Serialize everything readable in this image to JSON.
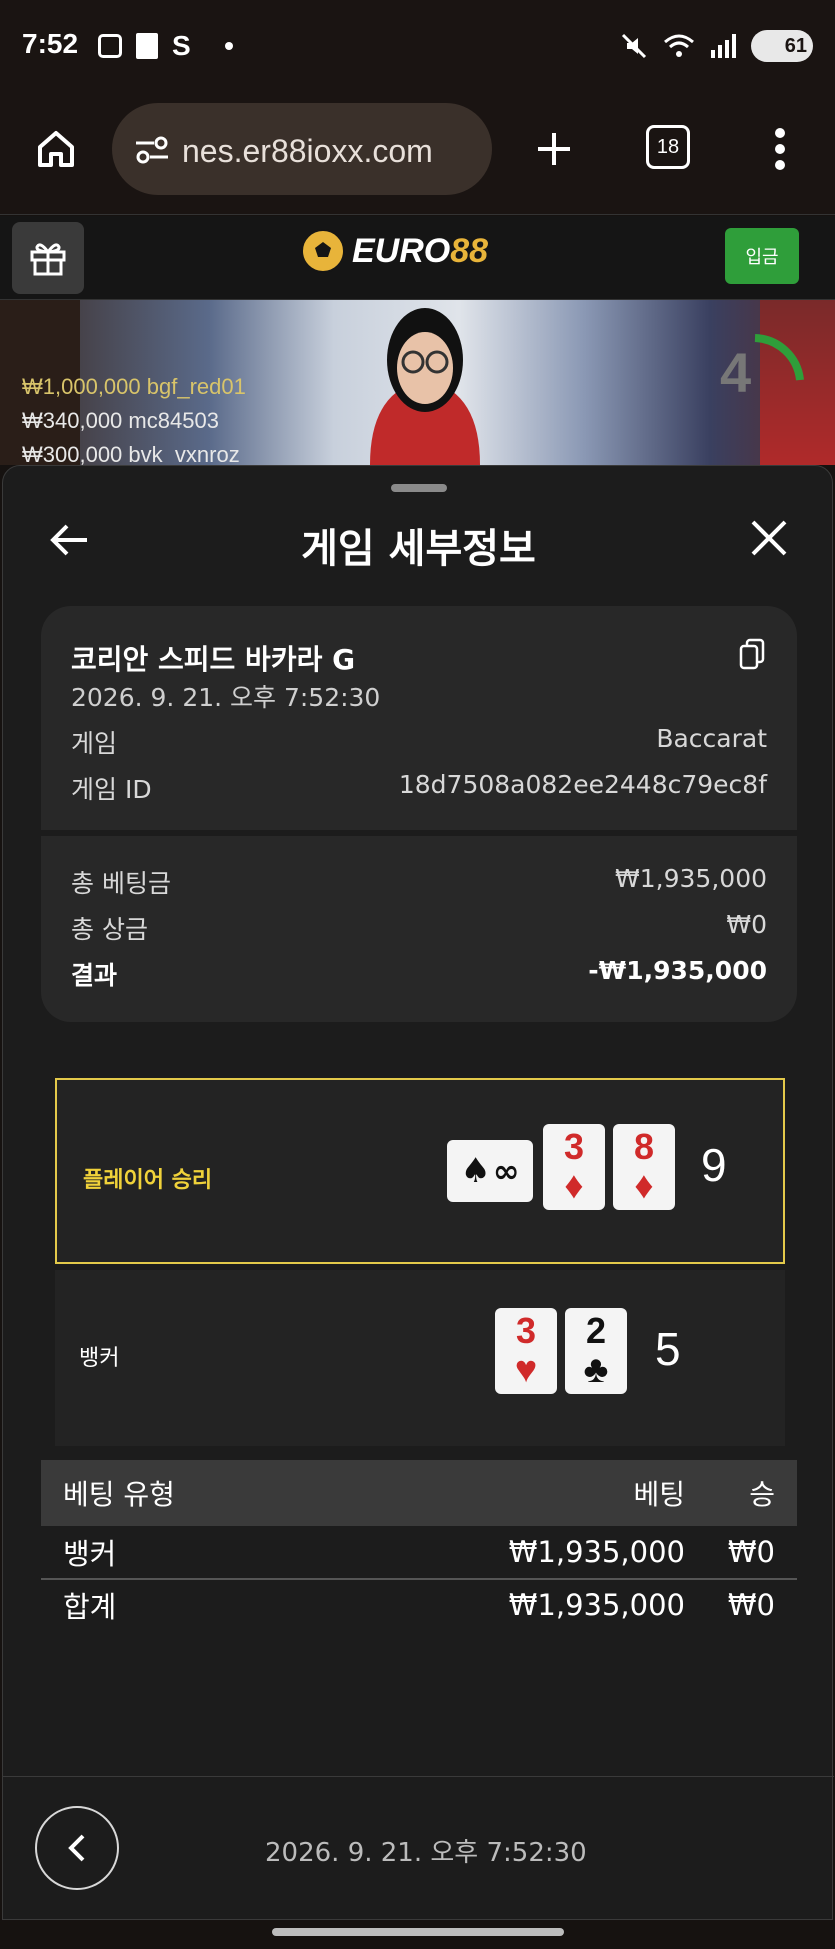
{
  "status_bar": {
    "time": "7:52",
    "letter": "S",
    "battery": "61"
  },
  "browser": {
    "url": "nes.er88ioxx.com",
    "tab_count": "18"
  },
  "site": {
    "logo_text_a": "EURO",
    "logo_text_b": "88",
    "deposit_label": "입금",
    "brand_color": "#e8b43a",
    "deposit_color": "#2f9e3a"
  },
  "live": {
    "winners": [
      {
        "amount": "₩1,000,000",
        "user": "bgf_red01"
      },
      {
        "amount": "₩340,000",
        "user": "mc84503"
      },
      {
        "amount": "₩300,000",
        "user": "bvk_vxnroz"
      }
    ],
    "countdown": "4"
  },
  "sheet": {
    "title": "게임 세부정보",
    "game_name": "코리안 스피드 바카라 G",
    "game_datetime": "2026. 9. 21. 오후 7:52:30",
    "info_rows": [
      {
        "label": "게임",
        "value": "Baccarat"
      },
      {
        "label": "게임 ID",
        "value": "18d7508a082ee2448c79ec8f"
      }
    ],
    "summary_rows": [
      {
        "label": "총 베팅금",
        "value": "₩1,935,000"
      },
      {
        "label": "총 상금",
        "value": "₩0"
      },
      {
        "label": "결과",
        "value": "-₩1,935,000"
      }
    ],
    "player": {
      "label": "플레이어 승리",
      "score": "9",
      "cards": [
        {
          "rank": "∞",
          "suit": "♠",
          "color": "black",
          "sideways": true
        },
        {
          "rank": "3",
          "suit": "♦",
          "color": "red"
        },
        {
          "rank": "8",
          "suit": "♦",
          "color": "red"
        }
      ]
    },
    "banker": {
      "label": "뱅커",
      "score": "5",
      "cards": [
        {
          "rank": "3",
          "suit": "♥",
          "color": "red"
        },
        {
          "rank": "2",
          "suit": "♣",
          "color": "black"
        }
      ]
    },
    "bets_table": {
      "headers": [
        "베팅 유형",
        "베팅",
        "승"
      ],
      "rows": [
        {
          "type": "뱅커",
          "bet": "₩1,935,000",
          "win": "₩0"
        }
      ],
      "total": {
        "type": "합계",
        "bet": "₩1,935,000",
        "win": "₩0"
      }
    },
    "footer_date": "2026. 9. 21. 오후 7:52:30",
    "highlight_color": "#e3c94a"
  }
}
